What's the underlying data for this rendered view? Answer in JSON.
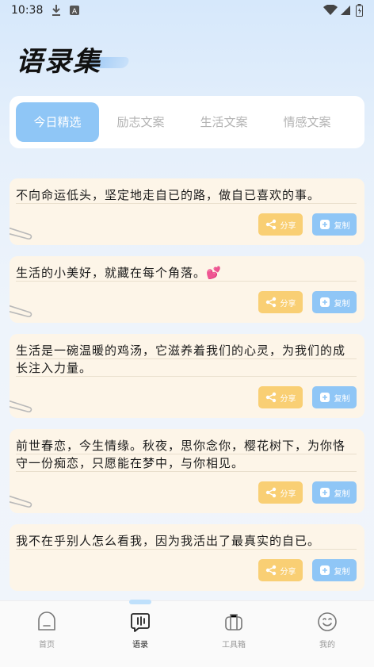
{
  "status_bar": {
    "time": "10:38"
  },
  "header": {
    "title": "语录集"
  },
  "tabs": [
    {
      "label": "今日精选",
      "active": true
    },
    {
      "label": "励志文案",
      "active": false
    },
    {
      "label": "生活文案",
      "active": false
    },
    {
      "label": "情感文案",
      "active": false
    }
  ],
  "quotes": [
    {
      "text": "不向命运低头，坚定地走自已的路，做自已喜欢的事。"
    },
    {
      "text": "生活的小美好，就藏在每个角落。💕"
    },
    {
      "text": "生活是一碗温暖的鸡汤，它滋养着我们的心灵，为我们的成长注入力量。"
    },
    {
      "text": "前世春恋，今生情缘。秋夜，思你念你，樱花树下，为你恪守一份痴恋，只愿能在梦中，与你相见。"
    },
    {
      "text": "我不在乎别人怎么看我，因为我活出了最真实的自已。"
    }
  ],
  "actions": {
    "share_label": "分享",
    "copy_label": "复制"
  },
  "bottom_nav": [
    {
      "label": "首页",
      "icon": "home-icon",
      "active": false
    },
    {
      "label": "语录",
      "icon": "quote-icon",
      "active": true
    },
    {
      "label": "工具箱",
      "icon": "toolbox-icon",
      "active": false
    },
    {
      "label": "我的",
      "icon": "smile-icon",
      "active": false
    }
  ],
  "colors": {
    "accent_blue": "#8fc6f6",
    "share_yellow": "#f9cf74",
    "card_bg": "#fdf5e8"
  }
}
